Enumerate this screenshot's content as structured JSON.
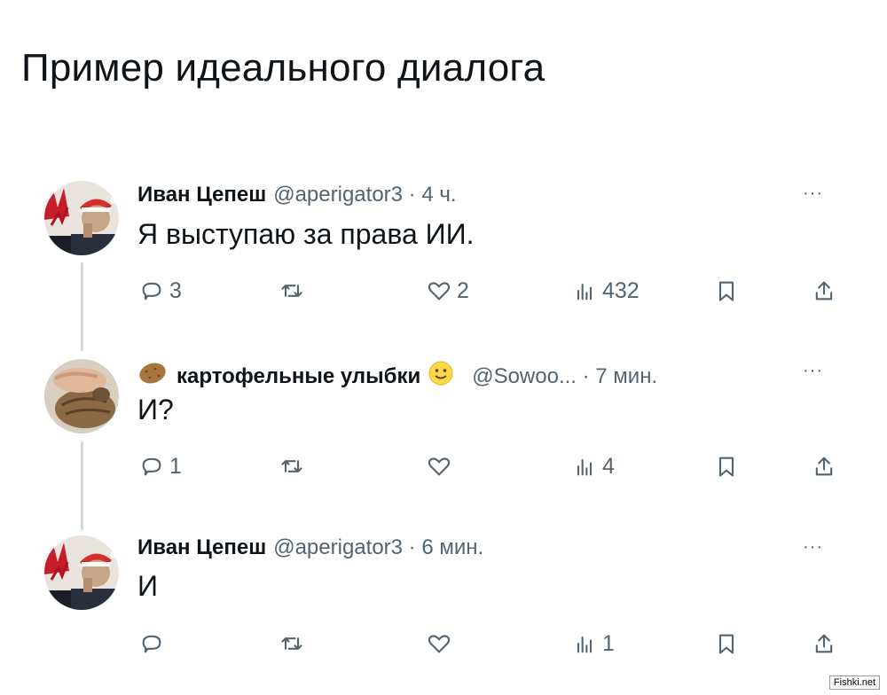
{
  "title": "Пример идеального диалога",
  "tweets": [
    {
      "name": "Иван Цепеш",
      "handle": "@aperigator3 · 4 ч.",
      "text": "Я выступаю за права ИИ.",
      "reply_count": "3",
      "retweet_count": "",
      "like_count": "2",
      "view_count": "432",
      "more": "···"
    },
    {
      "name_prefix_emoji": "potato",
      "name": "картофельные улыбки",
      "name_suffix_emoji": "slight-smile",
      "handle": "@Sowoo... · 7 мин.",
      "text": "И?",
      "reply_count": "1",
      "retweet_count": "",
      "like_count": "",
      "view_count": "4",
      "more": "···"
    },
    {
      "name": "Иван Цепеш",
      "handle": "@aperigator3 · 6 мин.",
      "text": "И",
      "reply_count": "",
      "retweet_count": "",
      "like_count": "",
      "view_count": "1",
      "more": "···"
    }
  ],
  "watermark": "Fishki.net",
  "colors": {
    "text": "#0f1419",
    "secondary": "#536471",
    "thread_line": "#cfd9de",
    "background": "#ffffff"
  }
}
